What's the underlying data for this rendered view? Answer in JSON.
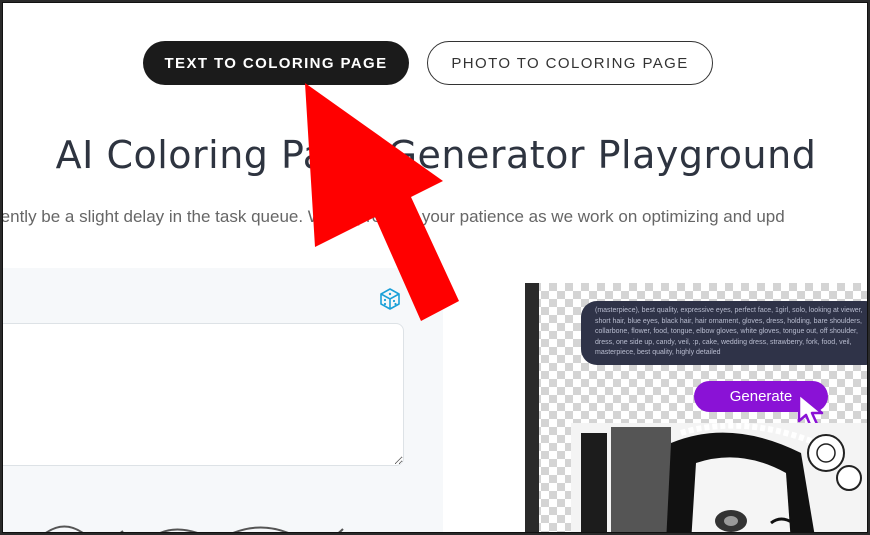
{
  "tabs": {
    "text_to_coloring": "TEXT TO COLORING PAGE",
    "photo_to_coloring": "PHOTO TO COLORING PAGE"
  },
  "heading": {
    "title": "AI Coloring Page Generator Playground",
    "notice": "rently be a slight delay in the task queue. We appreciate your patience as we work on optimizing and upd"
  },
  "left_panel": {
    "random_icon": "dice-icon",
    "prompt_value": ""
  },
  "preview": {
    "prompt_text": "(masterpiece), best quality, expressive eyes, perfect face, 1girl, solo, looking at viewer, short hair, blue eyes, black hair, hair ornament, gloves, dress, holding, bare shoulders, collarbone, flower, food, tongue, elbow gloves, white gloves, tongue out, off shoulder, dress, one side up, candy, veil, :p, cake, wedding dress, strawberry, fork, food, veil, masterpiece, best quality, highly detailed",
    "generate_label": "Generate",
    "cursor_icon": "hand-pointer-icon"
  },
  "overlay": {
    "arrow_color": "#ff0000",
    "annotation_icon": "red-arrow-icon"
  },
  "colors": {
    "tab_active_bg": "#1b1b1b",
    "generate_bg": "#8a12d6",
    "bubble_bg": "#2f3348"
  }
}
